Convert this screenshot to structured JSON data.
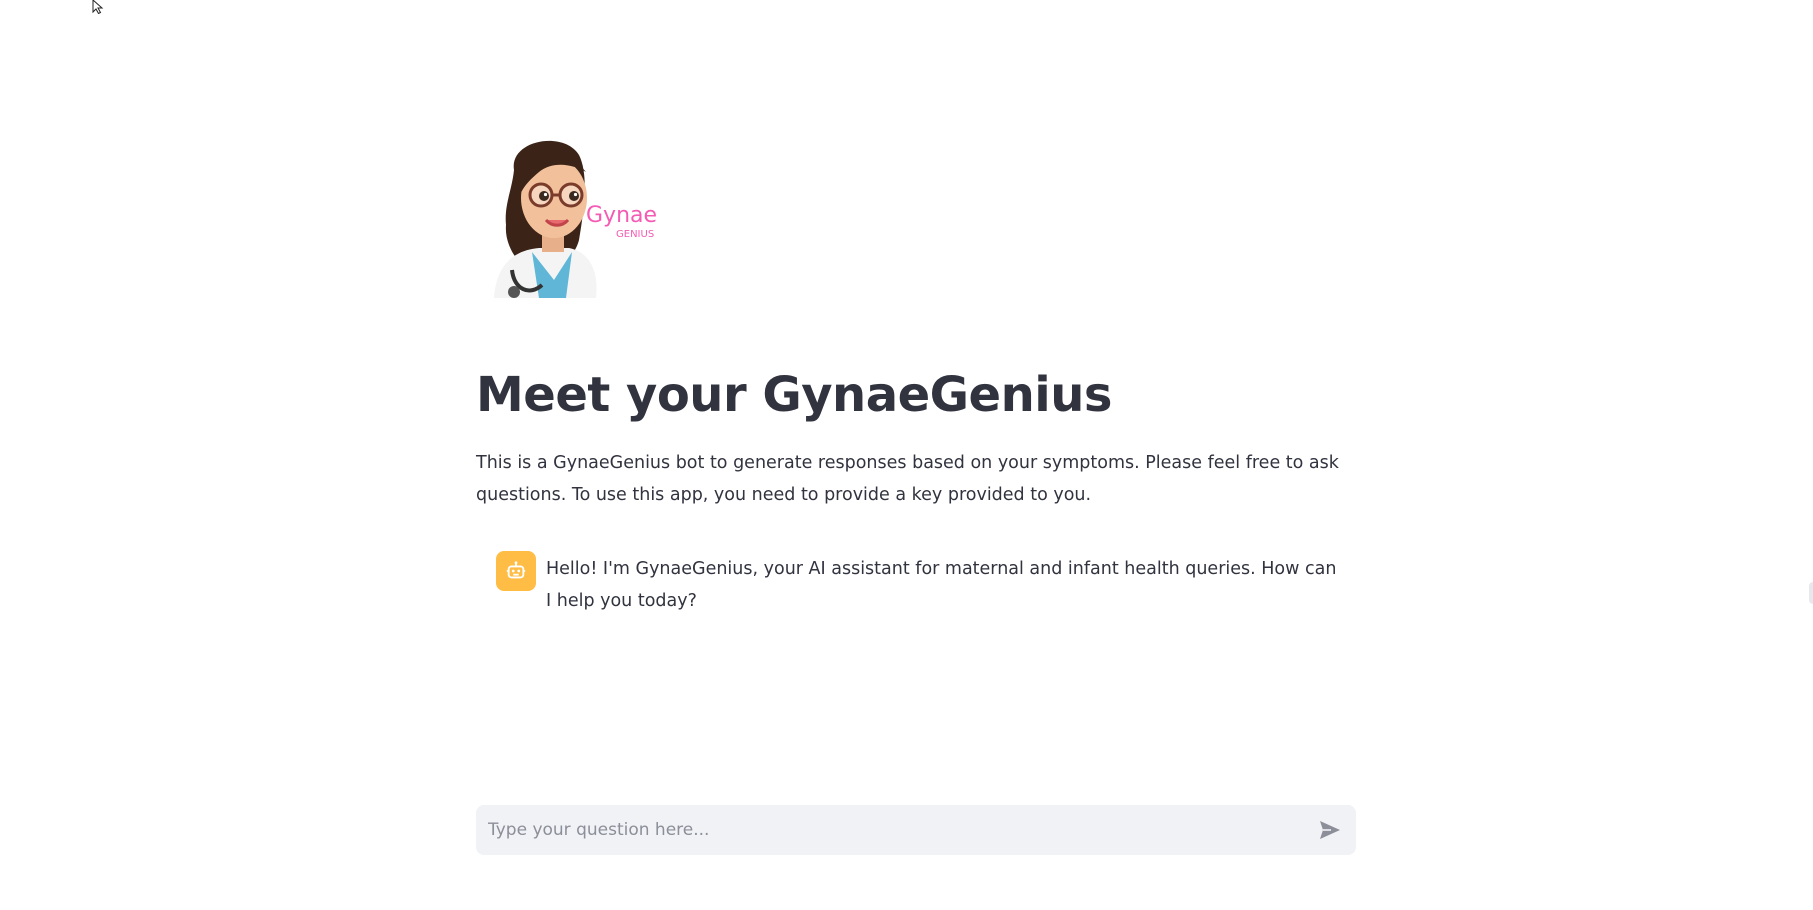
{
  "app": {
    "title": "Meet your GynaeGenius",
    "description": "This is a GynaeGenius bot to generate responses based on your symptoms. Please feel free to ask questions. To use this app, you need to provide a key provided to you."
  },
  "logo": {
    "brand_main": "Gynae",
    "brand_sub": "GENIUS",
    "brand_color": "#f45bb4"
  },
  "chat": {
    "messages": [
      {
        "role": "assistant",
        "avatar_icon": "bot-icon",
        "text": "Hello! I'm GynaeGenius, your AI assistant for maternal and infant health queries. How can I help you today?"
      }
    ],
    "input": {
      "placeholder": "Type your question here...",
      "value": ""
    },
    "send_icon": "send-icon"
  },
  "colors": {
    "text": "#31333f",
    "avatar_bg": "#ffbd45",
    "input_bg": "#f0f2f6",
    "placeholder": "#8c8e99",
    "send_icon": "#8c8e99"
  }
}
